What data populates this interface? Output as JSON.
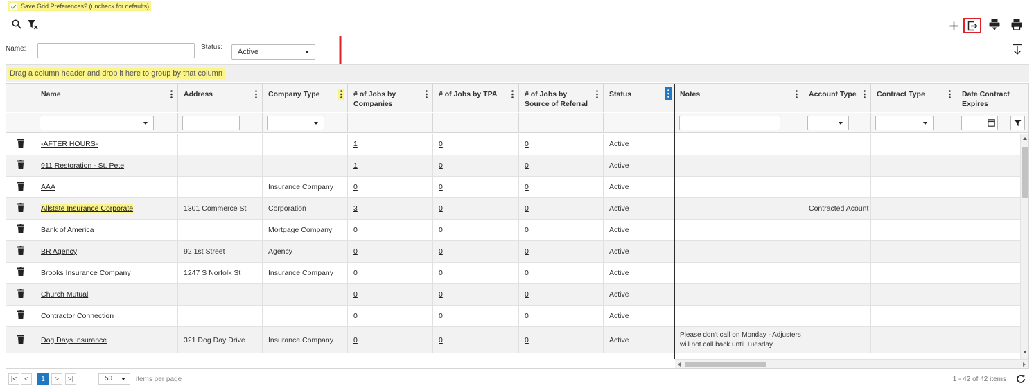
{
  "prefs": {
    "label": "Save Grid Preferences? (uncheck for defaults)",
    "checked": true
  },
  "toolbar": {
    "icons": [
      "search-icon",
      "clear-filter-icon",
      "add-icon",
      "export-icon",
      "print-filtered-icon",
      "print-icon",
      "sort-down-icon"
    ]
  },
  "filters": {
    "name_label": "Name:",
    "name_value": "",
    "status_label": "Status:",
    "status_value": "Active"
  },
  "group_hint": "Drag a column header and drop it here to group by that column",
  "columns": [
    "Name",
    "Address",
    "Company Type",
    "# of Jobs by Companies",
    "# of Jobs by TPA",
    "# of Jobs by Source of Referral",
    "Status",
    "Notes",
    "Account Type",
    "Contract Type",
    "Date Contract Expires"
  ],
  "rows": [
    {
      "name": "-AFTER HOURS-",
      "address": "",
      "company_type": "",
      "jobs_companies": "1",
      "jobs_tpa": "0",
      "jobs_referral": "0",
      "status": "Active",
      "notes": "",
      "account_type": ""
    },
    {
      "name": "911 Restoration - St. Pete",
      "address": "",
      "company_type": "",
      "jobs_companies": "1",
      "jobs_tpa": "0",
      "jobs_referral": "0",
      "status": "Active",
      "notes": "",
      "account_type": ""
    },
    {
      "name": "AAA",
      "address": "",
      "company_type": "Insurance Company",
      "jobs_companies": "0",
      "jobs_tpa": "0",
      "jobs_referral": "0",
      "status": "Active",
      "notes": "",
      "account_type": ""
    },
    {
      "name": "Allstate Insurance Corporate",
      "address": "1301 Commerce St",
      "company_type": "Corporation",
      "jobs_companies": "3",
      "jobs_tpa": "0",
      "jobs_referral": "0",
      "status": "Active",
      "notes": "",
      "account_type": "Contracted Acount"
    },
    {
      "name": "Bank of America",
      "address": "",
      "company_type": "Mortgage Company",
      "jobs_companies": "0",
      "jobs_tpa": "0",
      "jobs_referral": "0",
      "status": "Active",
      "notes": "",
      "account_type": ""
    },
    {
      "name": "BR Agency",
      "address": "92 1st Street",
      "company_type": "Agency",
      "jobs_companies": "0",
      "jobs_tpa": "0",
      "jobs_referral": "0",
      "status": "Active",
      "notes": "",
      "account_type": ""
    },
    {
      "name": "Brooks Insurance Company",
      "address": "1247 S Norfolk St",
      "company_type": "Insurance Company",
      "jobs_companies": "0",
      "jobs_tpa": "0",
      "jobs_referral": "0",
      "status": "Active",
      "notes": "",
      "account_type": ""
    },
    {
      "name": "Church Mutual",
      "address": "",
      "company_type": "",
      "jobs_companies": "0",
      "jobs_tpa": "0",
      "jobs_referral": "0",
      "status": "Active",
      "notes": "",
      "account_type": ""
    },
    {
      "name": "Contractor Connection",
      "address": "",
      "company_type": "",
      "jobs_companies": "0",
      "jobs_tpa": "0",
      "jobs_referral": "0",
      "status": "Active",
      "notes": "",
      "account_type": ""
    },
    {
      "name": "Dog Days Insurance",
      "address": "321 Dog Day Drive",
      "company_type": "Insurance Company",
      "jobs_companies": "0",
      "jobs_tpa": "0",
      "jobs_referral": "0",
      "status": "Active",
      "notes": "Please don't call on Monday - Adjusters will not call back until Tuesday.",
      "account_type": ""
    }
  ],
  "pager": {
    "first": "|<",
    "prev": "<",
    "page": "1",
    "next": ">",
    "last": ">|",
    "page_size": "50",
    "page_size_label": "items per page",
    "info": "1 - 42 of 42 items"
  },
  "colors": {
    "highlight": "#fbf589",
    "accent": "#1f78c1",
    "annotation": "#e0202a"
  }
}
